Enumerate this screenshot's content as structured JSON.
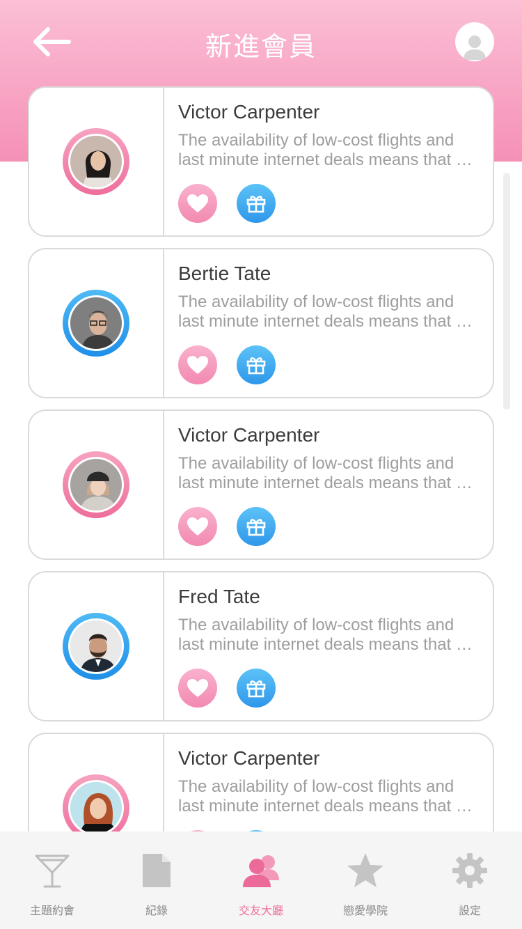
{
  "header": {
    "title": "新進會員",
    "gradient": [
      "#fbbfd6",
      "#f590b6"
    ]
  },
  "members": [
    {
      "name": "Victor Carpenter",
      "desc": "The availability of low-cost flights and\nlast minute internet deals means that …",
      "ring": "pink"
    },
    {
      "name": "Bertie Tate",
      "desc": "The availability of low-cost flights and\nlast minute internet deals means that …",
      "ring": "blue"
    },
    {
      "name": "Victor Carpenter",
      "desc": "The availability of low-cost flights and\nlast minute internet deals means that …",
      "ring": "pink"
    },
    {
      "name": "Fred Tate",
      "desc": "The availability of low-cost flights and\nlast minute internet deals means that …",
      "ring": "blue"
    },
    {
      "name": "Victor Carpenter",
      "desc": "The availability of low-cost flights and\nlast minute internet deals means that …",
      "ring": "pink"
    }
  ],
  "actions": {
    "like_icon": "heart-icon",
    "gift_icon": "gift-icon",
    "like_color": "#f289b1",
    "gift_color": "#2f97ea"
  },
  "tabs": [
    {
      "label": "主題約會",
      "icon": "cocktail-icon",
      "active": false
    },
    {
      "label": "紀錄",
      "icon": "document-icon",
      "active": false
    },
    {
      "label": "交友大廳",
      "icon": "people-icon",
      "active": true
    },
    {
      "label": "戀愛學院",
      "icon": "star-icon",
      "active": false
    },
    {
      "label": "設定",
      "icon": "gear-icon",
      "active": false
    }
  ],
  "colors": {
    "accent": "#ee6d9b",
    "inactive": "#8a8a8a",
    "tabbar_bg": "#f5f5f5"
  }
}
